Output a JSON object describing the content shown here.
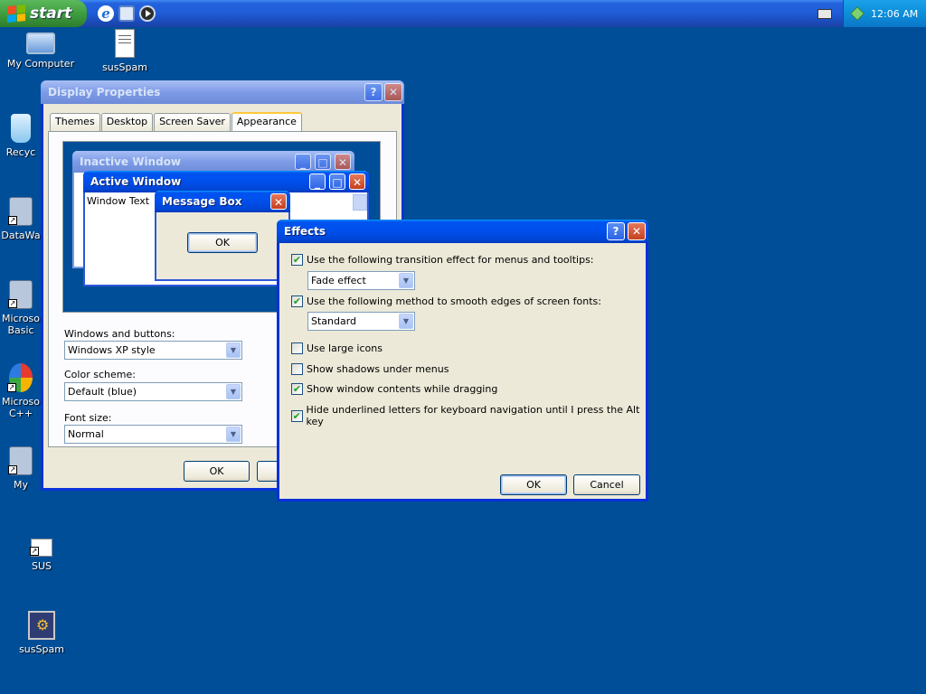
{
  "taskbar": {
    "start_label": "start",
    "quick_launch": [
      "ie-icon",
      "show-desktop-icon",
      "media-player-icon"
    ],
    "clock": "12:06 AM"
  },
  "desktop": {
    "icons": [
      {
        "label": "My Computer",
        "icon": "computer-icon"
      },
      {
        "label": "susSpam",
        "icon": "document-icon"
      },
      {
        "label": "Recyc",
        "icon": "recycle-bin-icon"
      },
      {
        "label": "DataWa",
        "icon": "application-icon"
      },
      {
        "label": "Microso",
        "label2": "Basic",
        "icon": "application-icon"
      },
      {
        "label": "Microso",
        "label2": "C++",
        "icon": "application-icon"
      },
      {
        "label": "My",
        "icon": "application-icon"
      },
      {
        "label": "SUS",
        "icon": "shortcut-icon"
      },
      {
        "label": "susSpam",
        "icon": "application-icon"
      }
    ]
  },
  "display_properties": {
    "title": "Display Properties",
    "tabs": [
      "Themes",
      "Desktop",
      "Screen Saver",
      "Appearance"
    ],
    "active_tab": "Appearance",
    "preview": {
      "inactive_title": "Inactive Window",
      "active_title": "Active Window",
      "window_text": "Window Text",
      "message_box_title": "Message Box",
      "message_box_ok": "OK"
    },
    "windows_and_buttons_label": "Windows and buttons:",
    "windows_and_buttons_value": "Windows XP style",
    "color_scheme_label": "Color scheme:",
    "color_scheme_value": "Default (blue)",
    "font_size_label": "Font size:",
    "font_size_value": "Normal",
    "ok_label": "OK"
  },
  "effects": {
    "title": "Effects",
    "options": [
      {
        "label": "Use the following transition effect for menus and tooltips:",
        "checked": true
      },
      {
        "label": "Use the following method to smooth edges of screen fonts:",
        "checked": true
      },
      {
        "label": "Use large icons",
        "checked": false
      },
      {
        "label": "Show shadows under menus",
        "checked": false
      },
      {
        "label": "Show window contents while dragging",
        "checked": true
      },
      {
        "label": "Hide underlined letters for keyboard navigation until I press the Alt key",
        "checked": true
      }
    ],
    "transition_value": "Fade effect",
    "smoothing_value": "Standard",
    "ok_label": "OK",
    "cancel_label": "Cancel"
  },
  "colors": {
    "desktop": "#004E98",
    "window_face": "#ECE9D8",
    "titlebar": "#0050EE"
  }
}
